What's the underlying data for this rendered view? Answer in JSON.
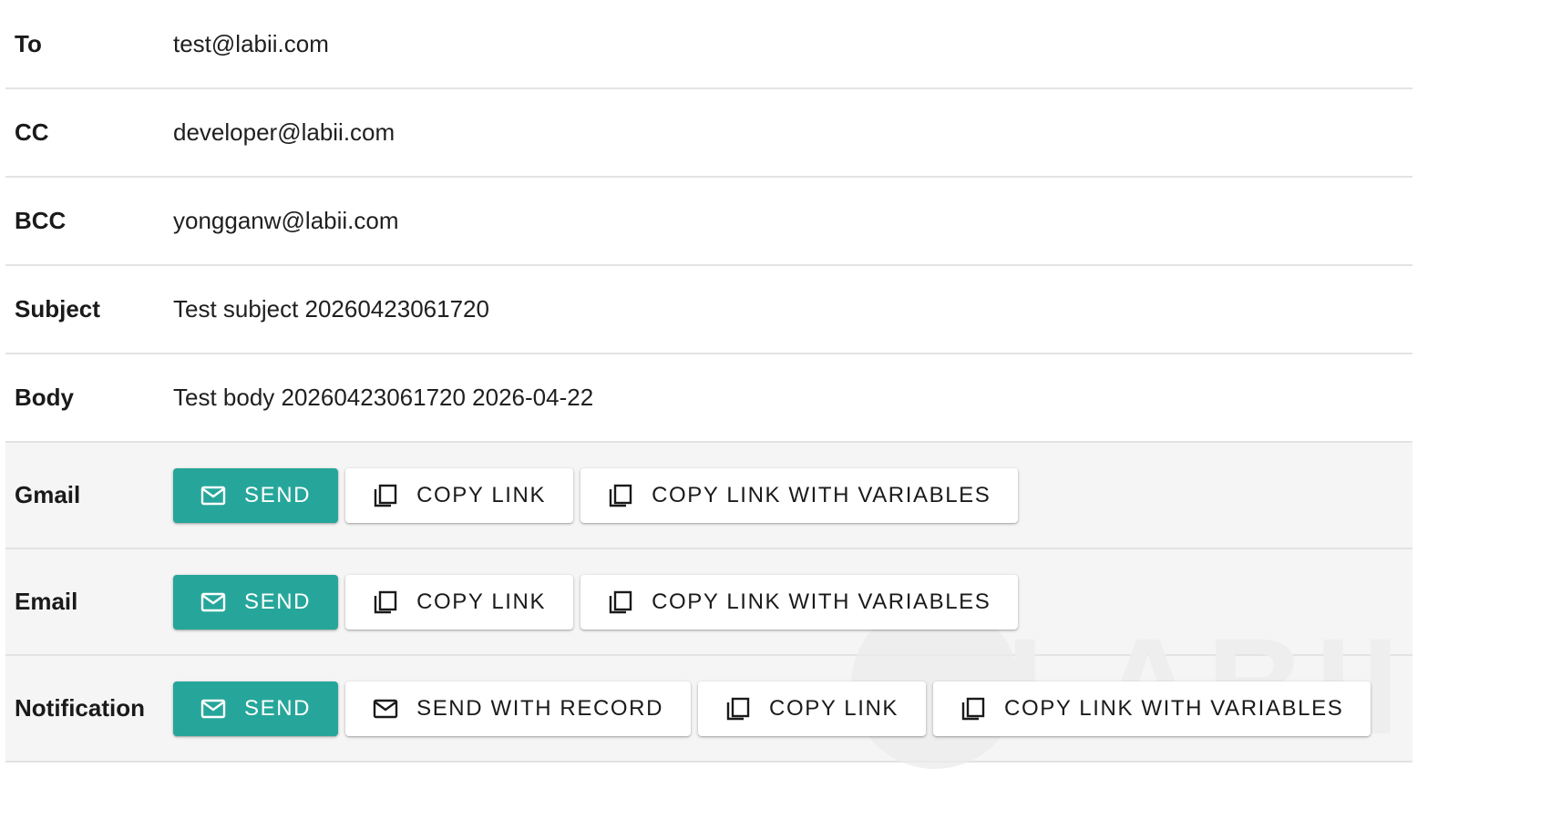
{
  "fields": [
    {
      "label": "To",
      "value": "test@labii.com"
    },
    {
      "label": "CC",
      "value": "developer@labii.com"
    },
    {
      "label": "BCC",
      "value": "yongganw@labii.com"
    },
    {
      "label": "Subject",
      "value": "Test subject 20260423061720"
    },
    {
      "label": "Body",
      "value": "Test body 20260423061720 2026-04-22"
    }
  ],
  "gmail": {
    "label": "Gmail",
    "send": "SEND",
    "copy_link": "COPY LINK",
    "copy_link_vars": "COPY LINK WITH VARIABLES"
  },
  "email": {
    "label": "Email",
    "send": "SEND",
    "copy_link": "COPY LINK",
    "copy_link_vars": "COPY LINK WITH VARIABLES"
  },
  "notification": {
    "label": "Notification",
    "send": "SEND",
    "send_with_record": "SEND WITH RECORD",
    "copy_link": "COPY LINK",
    "copy_link_vars": "COPY LINK WITH VARIABLES"
  },
  "watermark": {
    "text": "LABII"
  },
  "icons": {
    "send": "mail-icon",
    "copy": "copy-icon"
  },
  "colors": {
    "primary": "#26a69a"
  }
}
